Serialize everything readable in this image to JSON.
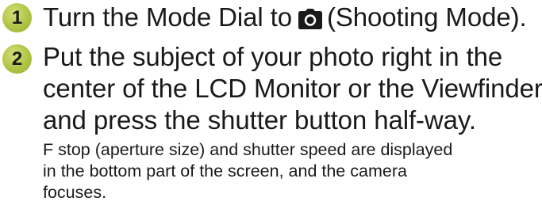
{
  "steps": [
    {
      "number": "1",
      "title_before_icon": "Turn the Mode Dial to",
      "icon": "camera-icon",
      "title_after_icon": "(Shooting Mode)."
    },
    {
      "number": "2",
      "title_lines": [
        "Put the subject of your photo right in the",
        "center of the LCD Monitor or the Viewfinder",
        "and press the shutter button half-way."
      ],
      "note_lines": [
        "F stop (aperture size) and shutter speed are displayed",
        "in the bottom part of the screen, and the camera",
        "focuses."
      ]
    }
  ],
  "colors": {
    "badge": "#b0c444",
    "text": "#1a1a1a"
  }
}
